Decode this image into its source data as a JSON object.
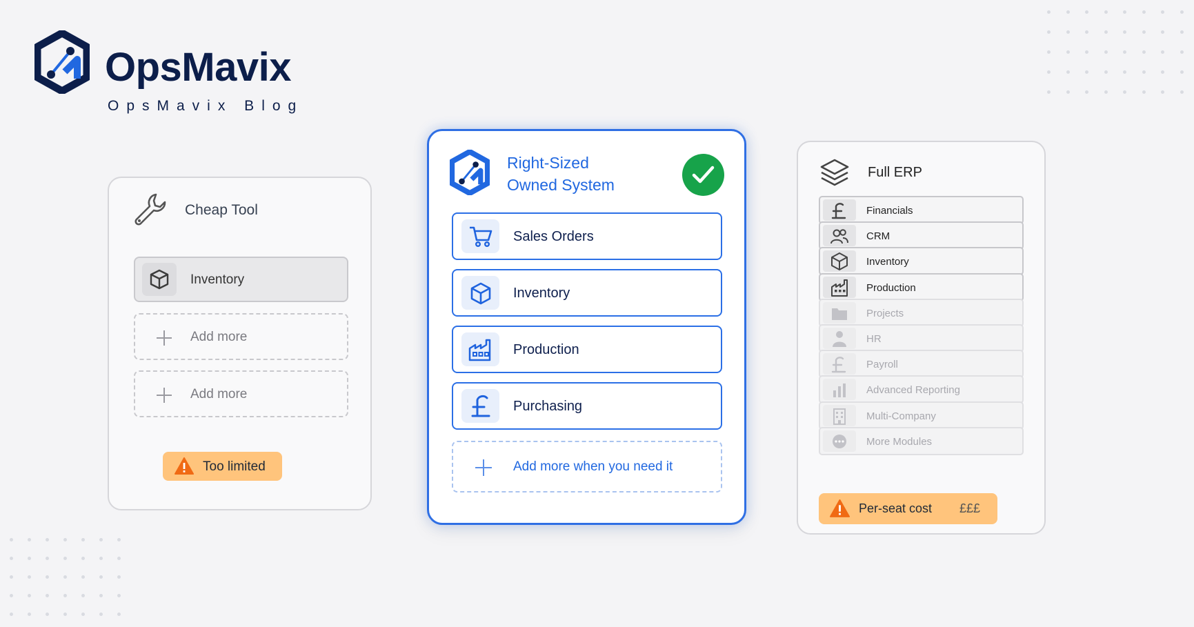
{
  "brand": {
    "name": "OpsMavix",
    "subtitle": "OpsMavix Blog",
    "colors": {
      "navy": "#0c1e4a",
      "blue": "#2168e0"
    }
  },
  "cheap_tool": {
    "title": "Cheap Tool",
    "icon": "wrench-icon",
    "items": [
      {
        "label": "Inventory",
        "icon": "box-icon"
      }
    ],
    "placeholders": [
      {
        "label": "Add more",
        "icon": "plus-icon"
      },
      {
        "label": "Add more",
        "icon": "plus-icon"
      }
    ],
    "warning": {
      "label": "Too limited",
      "icon": "warning-icon",
      "color": "#ffc47c"
    }
  },
  "right_sized": {
    "title_line1": "Right-Sized",
    "title_line2": "Owned System",
    "status_icon": "checkmark-icon",
    "status_color": "#17a34a",
    "accent": "#2b6fe6",
    "modules": [
      {
        "label": "Sales Orders",
        "icon": "cart-icon"
      },
      {
        "label": "Inventory",
        "icon": "box-icon"
      },
      {
        "label": "Production",
        "icon": "factory-icon"
      },
      {
        "label": "Purchasing",
        "icon": "pound-icon"
      }
    ],
    "add_more": {
      "label": "Add more when you need it",
      "icon": "plus-icon"
    }
  },
  "full_erp": {
    "title": "Full ERP",
    "icon": "layers-icon",
    "modules": [
      {
        "label": "Financials",
        "icon": "pound-icon",
        "active": true
      },
      {
        "label": "CRM",
        "icon": "users-icon",
        "active": true
      },
      {
        "label": "Inventory",
        "icon": "box-icon",
        "active": true
      },
      {
        "label": "Production",
        "icon": "factory-icon",
        "active": true
      },
      {
        "label": "Projects",
        "icon": "folder-icon",
        "active": false
      },
      {
        "label": "HR",
        "icon": "person-icon",
        "active": false
      },
      {
        "label": "Payroll",
        "icon": "pound-icon",
        "active": false
      },
      {
        "label": "Advanced Reporting",
        "icon": "bar-chart-icon",
        "active": false
      },
      {
        "label": "Multi-Company",
        "icon": "building-icon",
        "active": false
      },
      {
        "label": "More Modules",
        "icon": "more-icon",
        "active": false
      }
    ],
    "cost": {
      "label": "Per-seat cost",
      "value": "£££",
      "icon": "warning-icon",
      "color": "#ffc47c"
    }
  }
}
